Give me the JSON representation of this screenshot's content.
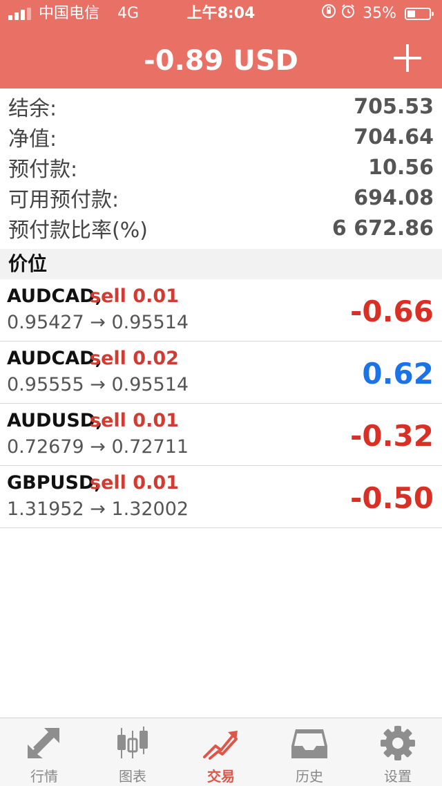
{
  "status_bar": {
    "carrier": "中国电信",
    "network": "4G",
    "time": "上午8:04",
    "battery_percent": "35%",
    "battery_level": 0.35
  },
  "header": {
    "balance_title": "-0.89 USD",
    "background_color": "#e87064"
  },
  "summary": [
    {
      "label": "结余:",
      "value": "705.53"
    },
    {
      "label": "净值:",
      "value": "704.64"
    },
    {
      "label": "预付款:",
      "value": "10.56"
    },
    {
      "label": "可用预付款:",
      "value": "694.08"
    },
    {
      "label": "预付款比率(%)",
      "value": "6 672.86"
    }
  ],
  "section_title": "价位",
  "positions": [
    {
      "symbol": "AUDCAD,",
      "type": "sell 0.01",
      "prices": "0.95427 → 0.95514",
      "profit": "-0.66",
      "profit_sign": "neg"
    },
    {
      "symbol": "AUDCAD,",
      "type": "sell 0.02",
      "prices": "0.95555 → 0.95514",
      "profit": "0.62",
      "profit_sign": "pos"
    },
    {
      "symbol": "AUDUSD,",
      "type": "sell 0.01",
      "prices": "0.72679 → 0.72711",
      "profit": "-0.32",
      "profit_sign": "neg"
    },
    {
      "symbol": "GBPUSD,",
      "type": "sell 0.01",
      "prices": "1.31952 → 1.32002",
      "profit": "-0.50",
      "profit_sign": "neg"
    }
  ],
  "colors": {
    "negative": "#d93025",
    "positive": "#1a73e8",
    "sell": "#d03b32",
    "tab_active": "#e0554a",
    "tab_inactive": "#888888"
  },
  "tabs": [
    {
      "label": "行情",
      "icon": "quotes-arrows-icon",
      "active": false
    },
    {
      "label": "图表",
      "icon": "candlestick-chart-icon",
      "active": false
    },
    {
      "label": "交易",
      "icon": "trade-trend-icon",
      "active": true
    },
    {
      "label": "历史",
      "icon": "history-inbox-icon",
      "active": false
    },
    {
      "label": "设置",
      "icon": "settings-gear-icon",
      "active": false
    }
  ]
}
